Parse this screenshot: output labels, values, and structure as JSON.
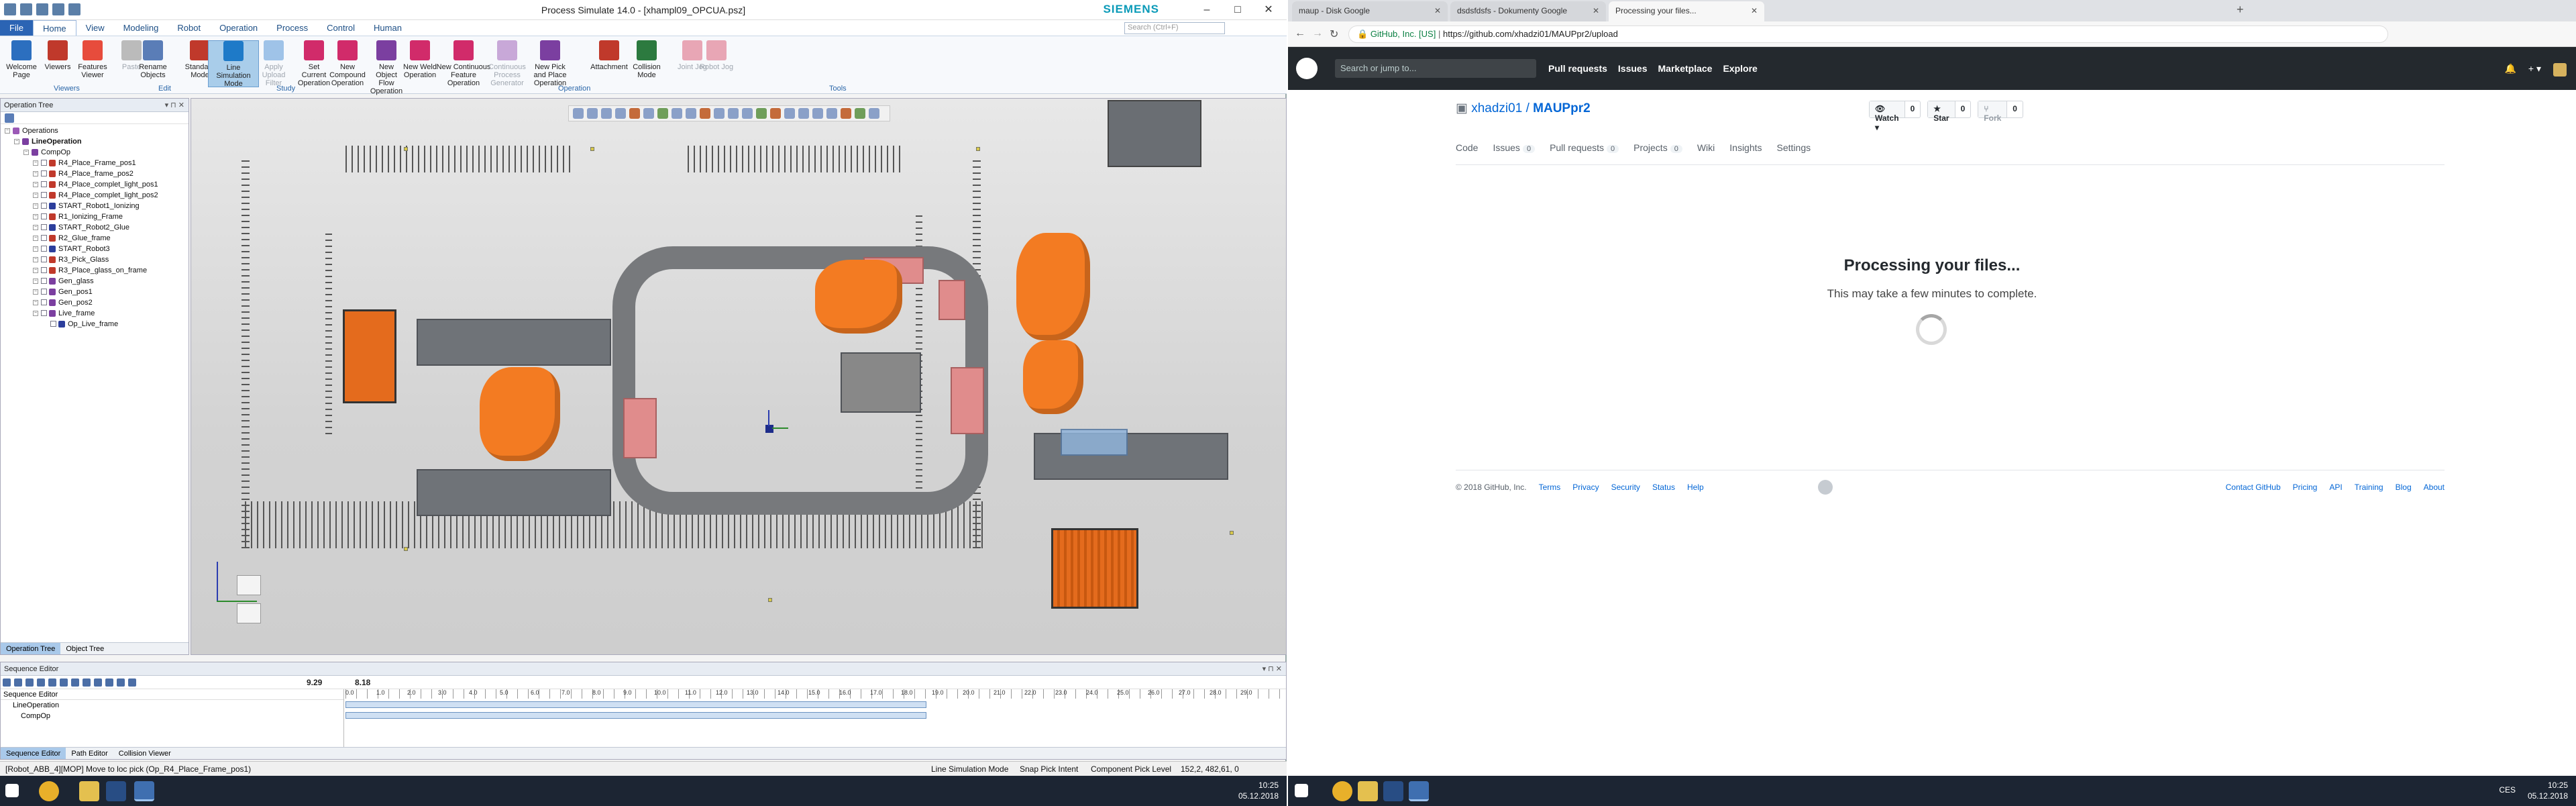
{
  "left_app": {
    "title": "Process Simulate 14.0 - [xhampl09_OPCUA.psz]",
    "brand": "SIEMENS",
    "menu": [
      "File",
      "Home",
      "View",
      "Modeling",
      "Robot",
      "Operation",
      "Process",
      "Control",
      "Human"
    ],
    "search_placeholder": "Search (Ctrl+F)",
    "ribbon": {
      "buttons": [
        {
          "label": "Welcome Page",
          "state": "normal"
        },
        {
          "label": "Viewers",
          "state": "normal"
        },
        {
          "label": "Features Viewer",
          "state": "normal"
        },
        {
          "label": "Paste",
          "state": "disabled"
        },
        {
          "label": "Rename Objects",
          "state": "normal"
        },
        {
          "label": "Standard Mode",
          "state": "normal"
        },
        {
          "label": "Line Simulation Mode",
          "state": "active"
        },
        {
          "label": "Apply Upload Filter",
          "state": "disabled"
        },
        {
          "label": "Set Current Operation",
          "state": "normal"
        },
        {
          "label": "New Compound Operation",
          "state": "normal"
        },
        {
          "label": "New Object Flow Operation",
          "state": "normal"
        },
        {
          "label": "New Weld Operation",
          "state": "normal"
        },
        {
          "label": "New Continuous Feature Operation",
          "state": "normal"
        },
        {
          "label": "Continuous Process Generator",
          "state": "disabled"
        },
        {
          "label": "New Pick and Place Operation",
          "state": "normal"
        },
        {
          "label": "Attachment",
          "state": "normal"
        },
        {
          "label": "Collision Mode",
          "state": "normal"
        },
        {
          "label": "Joint Jog",
          "state": "disabled"
        },
        {
          "label": "Robot Jog",
          "state": "disabled"
        }
      ],
      "groups": [
        "Viewers",
        "Edit",
        "Study",
        "Operation",
        "Tools"
      ]
    },
    "tree": {
      "title": "Operation Tree",
      "items": [
        {
          "label": "Operations",
          "level": 0,
          "icon": "#9b59b6"
        },
        {
          "label": "LineOperation",
          "level": 1,
          "icon": "#7b3fa0",
          "bold": true
        },
        {
          "label": "CompOp",
          "level": 2,
          "icon": "#7b3fa0"
        },
        {
          "label": "R4_Place_Frame_pos1",
          "level": 3,
          "icon": "#c0392b"
        },
        {
          "label": "R4_Place_frame_pos2",
          "level": 3,
          "icon": "#c0392b"
        },
        {
          "label": "R4_Place_complet_light_pos1",
          "level": 3,
          "icon": "#c0392b"
        },
        {
          "label": "R4_Place_complet_light_pos2",
          "level": 3,
          "icon": "#c0392b"
        },
        {
          "label": "START_Robot1_Ionizing",
          "level": 3,
          "icon": "#2c3e9c"
        },
        {
          "label": "R1_Ionizing_Frame",
          "level": 3,
          "icon": "#c0392b"
        },
        {
          "label": "START_Robot2_Glue",
          "level": 3,
          "icon": "#2c3e9c"
        },
        {
          "label": "R2_Glue_frame",
          "level": 3,
          "icon": "#c0392b"
        },
        {
          "label": "START_Robot3",
          "level": 3,
          "icon": "#2c3e9c"
        },
        {
          "label": "R3_Pick_Glass",
          "level": 3,
          "icon": "#c0392b"
        },
        {
          "label": "R3_Place_glass_on_frame",
          "level": 3,
          "icon": "#c0392b"
        },
        {
          "label": "Gen_glass",
          "level": 3,
          "icon": "#7b3fa0"
        },
        {
          "label": "Gen_pos1",
          "level": 3,
          "icon": "#7b3fa0"
        },
        {
          "label": "Gen_pos2",
          "level": 3,
          "icon": "#7b3fa0"
        },
        {
          "label": "Live_frame",
          "level": 3,
          "icon": "#7b3fa0"
        },
        {
          "label": "Op_Live_frame",
          "level": 4,
          "icon": "#2c3e9c"
        }
      ],
      "tabs": [
        "Operation Tree",
        "Object Tree"
      ]
    },
    "sequence": {
      "title": "Sequence Editor",
      "time_current": "9.29",
      "time_total": "8.18",
      "rows": [
        "LineOperation",
        "CompOp"
      ],
      "ruler": [
        "0.0",
        "1.0",
        "2.0",
        "3.0",
        "4.0",
        "5.0",
        "6.0",
        "7.0",
        "8.0",
        "9.0",
        "10.0",
        "11.0",
        "12.0",
        "13.0",
        "14.0",
        "15.0",
        "16.0",
        "17.0",
        "18.0",
        "19.0",
        "20.0",
        "21.0",
        "22.0",
        "23.0",
        "24.0",
        "25.0",
        "26.0",
        "27.0",
        "28.0",
        "29.0"
      ],
      "tabs": [
        "Sequence Editor",
        "Path Editor",
        "Collision Viewer"
      ]
    },
    "status": {
      "message": "[Robot_ABB_4][MOP] Move to loc pick (Op_R4_Place_Frame_pos1)",
      "mode": "Line Simulation Mode",
      "pick": "Snap Pick Intent",
      "level": "Component Pick Level",
      "coords": "152,2, 482,61, 0"
    },
    "taskbar_clock": {
      "time": "10:25",
      "date": "05.12.2018"
    }
  },
  "right_app": {
    "tabs": [
      {
        "label": "maup - Disk Google",
        "active": false
      },
      {
        "label": "dsdsfdsfs - Dokumenty Google",
        "active": false
      },
      {
        "label": "Processing your files...",
        "active": true
      }
    ],
    "url_secure": "GitHub, Inc. [US]",
    "url": "https://github.com/xhadzi01/MAUPpr2/upload",
    "search": "Search or jump to...",
    "nav": [
      "Pull requests",
      "Issues",
      "Marketplace",
      "Explore"
    ],
    "repo_owner": "xhadzi01",
    "repo_name": "MAUPpr2",
    "watch": {
      "label": "Watch",
      "count": "0"
    },
    "star": {
      "label": "Star",
      "count": "0"
    },
    "fork": {
      "label": "Fork",
      "count": "0"
    },
    "repo_tabs": [
      {
        "label": "Code",
        "count": ""
      },
      {
        "label": "Issues",
        "count": "0"
      },
      {
        "label": "Pull requests",
        "count": "0"
      },
      {
        "label": "Projects",
        "count": "0"
      },
      {
        "label": "Wiki",
        "count": ""
      },
      {
        "label": "Insights",
        "count": ""
      },
      {
        "label": "Settings",
        "count": ""
      }
    ],
    "heading": "Processing your files...",
    "subheading": "This may take a few minutes to complete.",
    "footer_left": [
      "© 2018 GitHub, Inc.",
      "Terms",
      "Privacy",
      "Security",
      "Status",
      "Help"
    ],
    "footer_right": [
      "Contact GitHub",
      "Pricing",
      "API",
      "Training",
      "Blog",
      "About"
    ],
    "taskbar_clock": {
      "time": "10:25",
      "date": "05.12.2018"
    },
    "lang": "CES"
  }
}
